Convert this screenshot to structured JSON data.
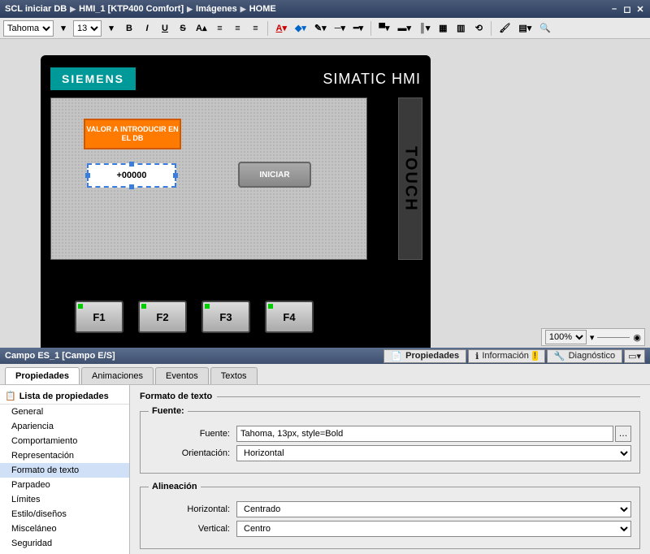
{
  "breadcrumb": [
    "SCL iniciar DB",
    "HMI_1 [KTP400 Comfort]",
    "Imágenes",
    "HOME"
  ],
  "toolbar": {
    "font": "Tahoma",
    "size": "13"
  },
  "hmi": {
    "brand": "SIEMENS",
    "product": "SIMATIC HMI",
    "touch": "TOUCH",
    "label_box": "VALOR A INTRODUCIR EN EL DB",
    "io_value": "+00000",
    "start_btn": "INICIAR",
    "fkeys": [
      "F1",
      "F2",
      "F3",
      "F4"
    ]
  },
  "zoom": "100%",
  "object_bar": {
    "title": "Campo ES_1 [Campo E/S]",
    "rtabs": [
      "Propiedades",
      "Información",
      "Diagnóstico"
    ]
  },
  "prop_tabs": [
    "Propiedades",
    "Animaciones",
    "Eventos",
    "Textos"
  ],
  "tree": {
    "header": "Lista de propiedades",
    "items": [
      "General",
      "Apariencia",
      "Comportamiento",
      "Representación",
      "Formato de texto",
      "Parpadeo",
      "Límites",
      "Estilo/diseños",
      "Misceláneo",
      "Seguridad"
    ],
    "selected": "Formato de texto"
  },
  "form": {
    "section": "Formato de texto",
    "fuente_group": "Fuente:",
    "fuente_label": "Fuente:",
    "fuente_value": "Tahoma, 13px, style=Bold",
    "orient_label": "Orientación:",
    "orient_value": "Horizontal",
    "align_group": "Alineación",
    "horiz_label": "Horizontal:",
    "horiz_value": "Centrado",
    "vert_label": "Vertical:",
    "vert_value": "Centro"
  }
}
